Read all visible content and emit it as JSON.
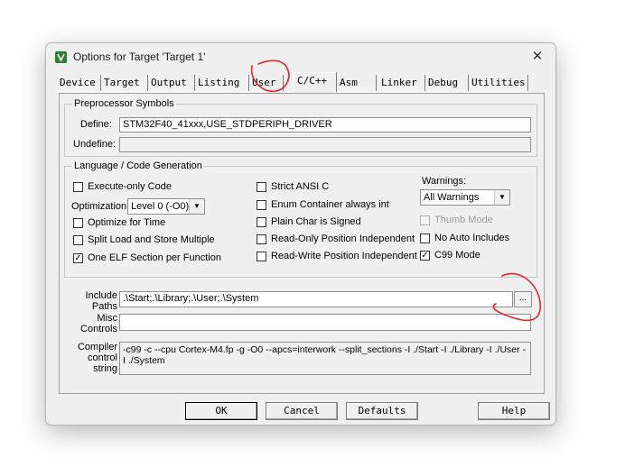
{
  "window": {
    "title": "Options for Target 'Target 1'",
    "close_glyph": "✕"
  },
  "tabs": [
    {
      "label": "Device"
    },
    {
      "label": "Target"
    },
    {
      "label": "Output"
    },
    {
      "label": "Listing"
    },
    {
      "label": "User"
    },
    {
      "label": "C/C++"
    },
    {
      "label": "Asm"
    },
    {
      "label": "Linker"
    },
    {
      "label": "Debug"
    },
    {
      "label": "Utilities"
    }
  ],
  "active_tab": "C/C++",
  "preprocessor": {
    "group_label": "Preprocessor Symbols",
    "define_label": "Define:",
    "define_value": "STM32F40_41xxx,USE_STDPERIPH_DRIVER",
    "undefine_label": "Undefine:",
    "undefine_value": ""
  },
  "language": {
    "group_label": "Language / Code Generation",
    "execute_only": {
      "label": "Execute-only Code",
      "checked": false
    },
    "optimization_label": "Optimization:",
    "optimization_value": "Level 0 (-O0)",
    "optimize_time": {
      "label": "Optimize for Time",
      "checked": false
    },
    "split_load_store": {
      "label": "Split Load and Store Multiple",
      "checked": false
    },
    "one_elf": {
      "label": "One ELF Section per Function",
      "checked": true
    },
    "strict_ansi": {
      "label": "Strict ANSI C",
      "checked": false
    },
    "enum_container": {
      "label": "Enum Container always int",
      "checked": false
    },
    "plain_char": {
      "label": "Plain Char is Signed",
      "checked": false
    },
    "ro_pi": {
      "label": "Read-Only Position Independent",
      "checked": false
    },
    "rw_pi": {
      "label": "Read-Write Position Independent",
      "checked": false
    },
    "warnings_label": "Warnings:",
    "warnings_value": "All Warnings",
    "thumb_mode": {
      "label": "Thumb Mode",
      "checked": false,
      "disabled": true
    },
    "no_auto_includes": {
      "label": "No Auto Includes",
      "checked": false
    },
    "c99_mode": {
      "label": "C99 Mode",
      "checked": true
    },
    "check_glyph": "✓"
  },
  "include_paths": {
    "label_line1": "Include",
    "label_line2": "Paths",
    "value": ".\\Start;.\\Library;.\\User;.\\System",
    "browse_label": "..."
  },
  "misc_controls": {
    "label_line1": "Misc",
    "label_line2": "Controls",
    "value": ""
  },
  "compiler_string": {
    "label_line1": "Compiler",
    "label_line2": "control",
    "label_line3": "string",
    "value": "-c99 -c --cpu Cortex-M4.fp -g -O0 --apcs=interwork --split_sections -I ./Start -I ./Library -I ./User -I ./System"
  },
  "buttons": {
    "ok": "OK",
    "cancel": "Cancel",
    "defaults": "Defaults",
    "help": "Help"
  },
  "colors": {
    "annotation": "#e5252a",
    "dialog_bg": "#f0f0f0",
    "app_icon": "#2e7d32"
  },
  "icons": {
    "app": "keil-options-icon",
    "dropdown": "chevron-down-icon",
    "close": "close-icon"
  }
}
